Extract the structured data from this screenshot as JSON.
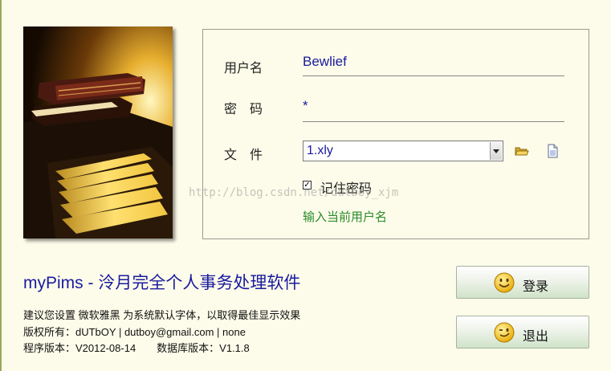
{
  "form": {
    "username_label": "用户名",
    "username_value": "Bewlief",
    "password_label": "密　码",
    "password_value": "*",
    "file_label": "文　件",
    "file_value": "1.xly",
    "remember_label": "记住密码",
    "remember_checked": true,
    "hint": "输入当前用户名"
  },
  "app": {
    "title": "myPims - 泠月完全个人事务处理软件",
    "info_font": "建议您设置 微软雅黑 为系统默认字体，以取得最佳显示效果",
    "info_copyright": "版权所有：dUTbOY | dutboy@gmail.com | none",
    "info_version": "程序版本：V2012-08-14　　数据库版本：V1.1.8"
  },
  "buttons": {
    "login": "登录",
    "exit": "退出"
  },
  "watermark": "http://blog.csdn.net/dutboy_xjm",
  "icons": {
    "open": "folder-open-icon",
    "new": "new-file-icon",
    "login_face": "smiley-icon",
    "exit_face": "wink-smiley-icon"
  },
  "colors": {
    "background": "#fdfcea",
    "value_text": "#1a1aa0",
    "hint_text": "#2a8a2a"
  }
}
